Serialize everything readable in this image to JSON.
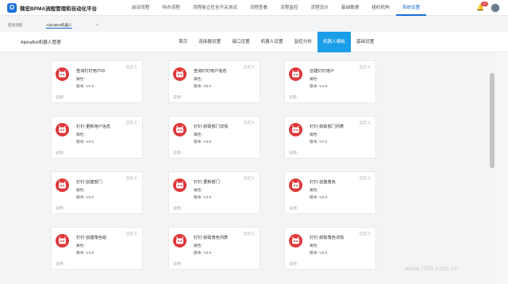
{
  "brand": {
    "logo_text": "O",
    "name": "微宏BPMA流程管理和自动化平台"
  },
  "topnav": [
    "启动流程",
    "待办流程",
    "流程接立任全开关测试",
    "流程查看",
    "流程监控",
    "流程设计",
    "基础数据",
    "组织机构",
    "系统设置"
  ],
  "notification": {
    "badge": "12"
  },
  "tabs": [
    {
      "label": "启动流程"
    },
    {
      "label": "AlphaBot机器人"
    }
  ],
  "tab_close": "×",
  "subbar": {
    "title": "AlphaBot机器人管理",
    "nav": [
      "首页",
      "连接器设置",
      "接口设置",
      "机器人设置",
      "监控分析",
      "机器人模板",
      "基础设置"
    ]
  },
  "card_custom_label": "自定义",
  "card_attr_label": "属性:",
  "card_desc_label": "说明:",
  "cards": [
    {
      "title": "查询钉钉用户ID",
      "version": "版本: V7.0"
    },
    {
      "title": "查询钉钉用户信息",
      "version": "版本: V5.0"
    },
    {
      "title": "创建钉钉用户",
      "version": "版本: V4.0"
    },
    {
      "title": "钉钉-更新用户信息",
      "version": "版本: V3.0"
    },
    {
      "title": "钉钉-获取部门详情",
      "version": "版本: V3.0"
    },
    {
      "title": "钉钉-获取部门列表",
      "version": "版本: V7.0"
    },
    {
      "title": "钉钉-创建部门",
      "version": "版本: V3.0"
    },
    {
      "title": "钉钉-更新部门",
      "version": "版本: V3.0"
    },
    {
      "title": "钉钉-创建角色",
      "version": "版本: V3.0"
    },
    {
      "title": "钉钉-创建角色组",
      "version": "版本: V4.0"
    },
    {
      "title": "钉钉-获取角色列表",
      "version": "版本: V3.0"
    },
    {
      "title": "钉钉-获取角色详情",
      "version": "版本: V3.0"
    }
  ],
  "watermark": "www.it00.com.cn",
  "colors": {
    "accent": "#1b9ee8",
    "robot": "#e0383a",
    "nav_active": "#1b6fd8"
  }
}
